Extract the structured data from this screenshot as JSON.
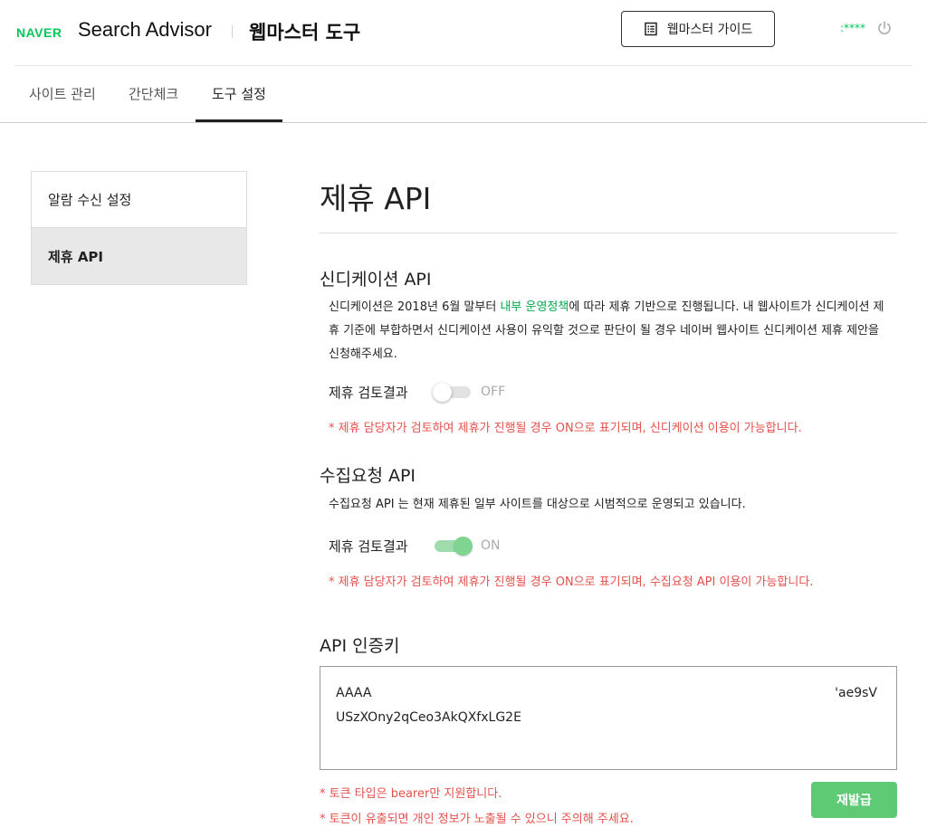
{
  "header": {
    "logo": "NAVER",
    "brand": "Search Advisor",
    "tool_title": "웹마스터 도구",
    "guide_button": "웹마스터 가이드",
    "user": ":****"
  },
  "tabs": [
    {
      "label": "사이트 관리",
      "active": false
    },
    {
      "label": "간단체크",
      "active": false
    },
    {
      "label": "도구 설정",
      "active": true
    }
  ],
  "side_menu": [
    {
      "label": "알람 수신 설정",
      "active": false
    },
    {
      "label": "제휴 API",
      "active": true
    }
  ],
  "main": {
    "title": "제휴 API",
    "syndication": {
      "title": "신디케이션 API",
      "desc_before": "신디케이션은 2018년 6월 말부터 ",
      "desc_link": "내부 운영정책",
      "desc_after": "에 따라 제휴 기반으로 진행됩니다. 내 웹사이트가 신디케이션 제휴 기준에 부합하면서 신디케이션 사용이 유익할 것으로 판단이 될 경우 네이버 웹사이트 신디케이션 제휴 제안을 신청해주세요.",
      "toggle_label": "제휴 검토결과",
      "toggle_state": "OFF",
      "note": "* 제휴 담당자가 검토하여 제휴가 진행될 경우 ON으로 표기되며, 신디케이션 이용이 가능합니다."
    },
    "crawl": {
      "title": "수집요청 API",
      "desc": "수집요청 API 는 현재 제휴된 일부 사이트를 대상으로 시범적으로 운영되고 있습니다.",
      "toggle_label": "제휴 검토결과",
      "toggle_state": "ON",
      "note": "* 제휴 담당자가 검토하여 제휴가 진행될 경우 ON으로 표기되며, 수집요청 API 이용이 가능합니다."
    },
    "api_key": {
      "title": "API 인증키",
      "line1_left": "AAAA",
      "line1_right": "'ae9sV",
      "line2": "USzXOny2qCeo3AkQXfxLG2E",
      "note1": "* 토큰 타입은 bearer만 지원합니다.",
      "note2": "* 토큰이 유출되면 개인 정보가 노출될 수 있으니 주의해 주세요.",
      "reissue_button": "재발급"
    }
  },
  "colors": {
    "brand_green": "#03c75a",
    "link_green": "#03a94d",
    "warning_red": "#e5504b",
    "button_green": "#5fca74"
  }
}
